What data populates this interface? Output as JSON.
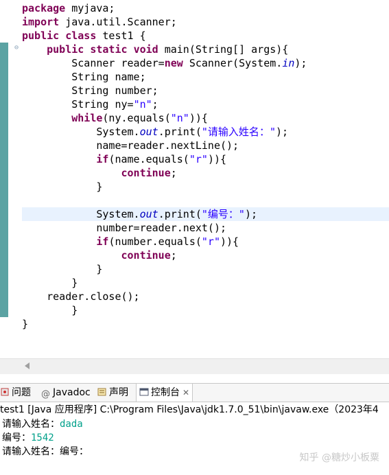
{
  "editor": {
    "lines": [
      {
        "parts": [
          {
            "t": "package",
            "c": "kw"
          },
          {
            "t": " myjava;"
          }
        ]
      },
      {
        "parts": [
          {
            "t": "import",
            "c": "kw"
          },
          {
            "t": " java.util.Scanner;"
          }
        ]
      },
      {
        "parts": [
          {
            "t": "public",
            "c": "kw"
          },
          {
            "t": " "
          },
          {
            "t": "class",
            "c": "kw"
          },
          {
            "t": " test1 {"
          }
        ]
      },
      {
        "parts": [
          {
            "t": "    "
          },
          {
            "t": "public",
            "c": "kw"
          },
          {
            "t": " "
          },
          {
            "t": "static",
            "c": "kw"
          },
          {
            "t": " "
          },
          {
            "t": "void",
            "c": "kw"
          },
          {
            "t": " main(String[] args){"
          }
        ]
      },
      {
        "parts": [
          {
            "t": "        Scanner reader="
          },
          {
            "t": "new",
            "c": "kw"
          },
          {
            "t": " Scanner(System."
          },
          {
            "t": "in",
            "c": "fld"
          },
          {
            "t": ");"
          }
        ]
      },
      {
        "parts": [
          {
            "t": "        String name;"
          }
        ]
      },
      {
        "parts": [
          {
            "t": "        String number;"
          }
        ]
      },
      {
        "parts": [
          {
            "t": "        String ny="
          },
          {
            "t": "\"n\"",
            "c": "str"
          },
          {
            "t": ";"
          }
        ]
      },
      {
        "parts": [
          {
            "t": "        "
          },
          {
            "t": "while",
            "c": "kw"
          },
          {
            "t": "(ny.equals("
          },
          {
            "t": "\"n\"",
            "c": "str"
          },
          {
            "t": ")){"
          }
        ]
      },
      {
        "parts": [
          {
            "t": "            System."
          },
          {
            "t": "out",
            "c": "fld"
          },
          {
            "t": ".print("
          },
          {
            "t": "\"请输入姓名：\"",
            "c": "str"
          },
          {
            "t": ");"
          }
        ]
      },
      {
        "parts": [
          {
            "t": "            name=reader.nextLine();"
          }
        ]
      },
      {
        "parts": [
          {
            "t": "            "
          },
          {
            "t": "if",
            "c": "kw"
          },
          {
            "t": "(name.equals("
          },
          {
            "t": "\"r\"",
            "c": "str"
          },
          {
            "t": ")){"
          }
        ]
      },
      {
        "parts": [
          {
            "t": "                "
          },
          {
            "t": "continue",
            "c": "kw"
          },
          {
            "t": ";"
          }
        ]
      },
      {
        "parts": [
          {
            "t": "            }"
          }
        ]
      },
      {
        "parts": [
          {
            "t": ""
          }
        ]
      },
      {
        "parts": [
          {
            "t": "            System."
          },
          {
            "t": "out",
            "c": "fld"
          },
          {
            "t": ".print("
          },
          {
            "t": "\"编号：\"",
            "c": "str"
          },
          {
            "t": ");"
          }
        ]
      },
      {
        "parts": [
          {
            "t": "            number=reader.next();"
          }
        ]
      },
      {
        "parts": [
          {
            "t": "            "
          },
          {
            "t": "if",
            "c": "kw"
          },
          {
            "t": "(number.equals("
          },
          {
            "t": "\"r\"",
            "c": "str"
          },
          {
            "t": ")){"
          }
        ]
      },
      {
        "parts": [
          {
            "t": "                "
          },
          {
            "t": "continue",
            "c": "kw"
          },
          {
            "t": ";"
          }
        ]
      },
      {
        "parts": [
          {
            "t": "            }"
          }
        ]
      },
      {
        "parts": [
          {
            "t": "        }"
          }
        ]
      },
      {
        "parts": [
          {
            "t": "    reader.close();"
          }
        ]
      },
      {
        "parts": [
          {
            "t": "        }"
          }
        ]
      },
      {
        "parts": [
          {
            "t": "}"
          }
        ]
      }
    ]
  },
  "tabs": [
    {
      "label": "问题",
      "icon": "problems-icon"
    },
    {
      "label": "Javadoc",
      "icon": "at-icon"
    },
    {
      "label": "声明",
      "icon": "declaration-icon"
    },
    {
      "label": "控制台",
      "icon": "console-icon",
      "active": true
    }
  ],
  "console": {
    "title": "test1 [Java 应用程序] C:\\Program Files\\Java\\jdk1.7.0_51\\bin\\javaw.exe（2023年4",
    "lines": [
      {
        "prompt": "请输入姓名：",
        "input": "dada"
      },
      {
        "prompt": "编号：",
        "input": "1542"
      },
      {
        "prompt": "请输入姓名：编号：",
        "input": ""
      }
    ]
  },
  "watermark": "知乎 @糖炒小板粟",
  "colors": {
    "keyword": "#7f0055",
    "string": "#2a00ff",
    "field": "#0000c0",
    "user_input": "#00a08a",
    "gutter": "#5ba3a3",
    "current_line": "#e8f2fe"
  }
}
